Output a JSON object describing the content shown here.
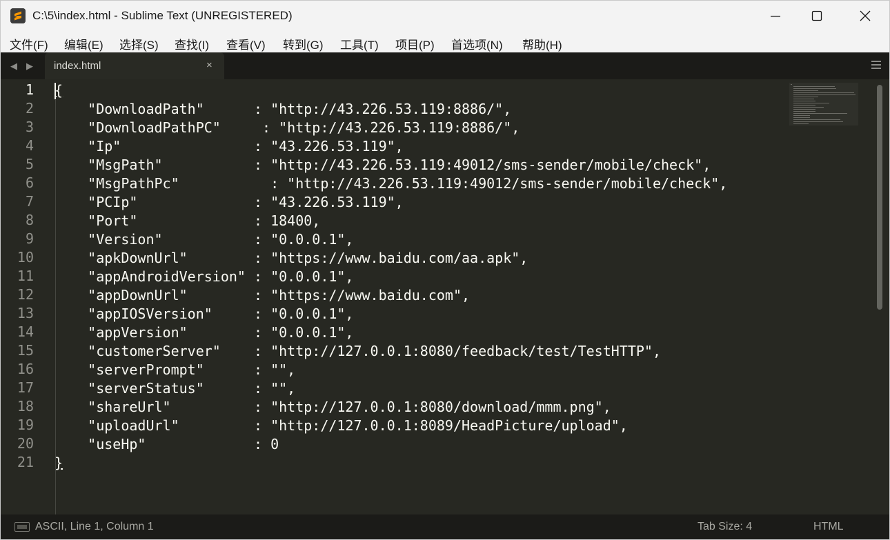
{
  "window": {
    "title": "C:\\5\\index.html - Sublime Text (UNREGISTERED)",
    "icon": "sublime-text-logo-icon"
  },
  "menu": [
    "文件(F)",
    "编辑(E)",
    "选择(S)",
    "查找(I)",
    "查看(V)",
    "转到(G)",
    "工具(T)",
    "项目(P)",
    "首选项(N)",
    "帮助(H)"
  ],
  "tabs": [
    {
      "label": "index.html",
      "close": "×",
      "active": true
    }
  ],
  "editor": {
    "line_numbers": [
      "1",
      "2",
      "3",
      "4",
      "5",
      "6",
      "7",
      "8",
      "9",
      "10",
      "11",
      "12",
      "13",
      "14",
      "15",
      "16",
      "17",
      "18",
      "19",
      "20",
      "21"
    ],
    "lines": [
      "{",
      "    \"DownloadPath\"      : \"http://43.226.53.119:8886/\",",
      "    \"DownloadPathPC\"     : \"http://43.226.53.119:8886/\",",
      "    \"Ip\"                : \"43.226.53.119\",",
      "    \"MsgPath\"           : \"http://43.226.53.119:49012/sms-sender/mobile/check\",",
      "    \"MsgPathPc\"           : \"http://43.226.53.119:49012/sms-sender/mobile/check\",",
      "    \"PCIp\"              : \"43.226.53.119\",",
      "    \"Port\"              : 18400,",
      "    \"Version\"           : \"0.0.0.1\",",
      "    \"apkDownUrl\"        : \"https://www.baidu.com/aa.apk\",",
      "    \"appAndroidVersion\" : \"0.0.0.1\",",
      "    \"appDownUrl\"        : \"https://www.baidu.com\",",
      "    \"appIOSVersion\"     : \"0.0.0.1\",",
      "    \"appVersion\"        : \"0.0.0.1\",",
      "    \"customerServer\"    : \"http://127.0.0.1:8080/feedback/test/TestHTTP\",",
      "    \"serverPrompt\"      : \"\",",
      "    \"serverStatus\"      : \"\",",
      "    \"shareUrl\"          : \"http://127.0.0.1:8080/download/mmm.png\",",
      "    \"uploadUrl\"         : \"http://127.0.0.1:8089/HeadPicture/upload\",",
      "    \"useHp\"             : 0",
      "}"
    ]
  },
  "status": {
    "position": "ASCII, Line 1, Column 1",
    "tab_size": "Tab Size: 4",
    "syntax": "HTML"
  },
  "colors": {
    "editor_bg": "#272822",
    "chrome_bg": "#1b1b18",
    "text": "#f8f8f2",
    "gutter_text": "#90908a"
  }
}
